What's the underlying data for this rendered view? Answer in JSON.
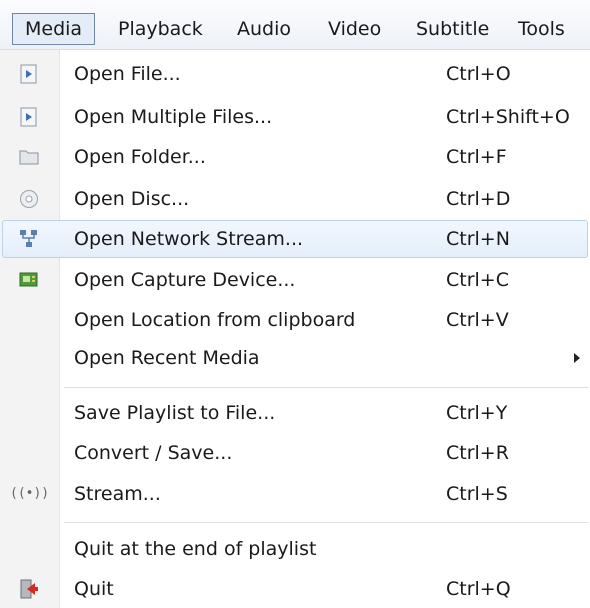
{
  "menubar": {
    "items": [
      {
        "label": "Media",
        "active": true
      },
      {
        "label": "Playback"
      },
      {
        "label": "Audio"
      },
      {
        "label": "Video"
      },
      {
        "label": "Subtitle"
      },
      {
        "label": "Tools"
      }
    ]
  },
  "menu": {
    "items": [
      {
        "label": "Open File...",
        "shortcut": "Ctrl+O",
        "icon": "file-play-icon"
      },
      {
        "label": "Open Multiple Files...",
        "shortcut": "Ctrl+Shift+O",
        "icon": "file-play-icon"
      },
      {
        "label": "Open Folder...",
        "shortcut": "Ctrl+F",
        "icon": "folder-icon"
      },
      {
        "label": "Open Disc...",
        "shortcut": "Ctrl+D",
        "icon": "disc-icon"
      },
      {
        "label": "Open Network Stream...",
        "shortcut": "Ctrl+N",
        "icon": "network-icon",
        "hovered": true
      },
      {
        "label": "Open Capture Device...",
        "shortcut": "Ctrl+C",
        "icon": "capture-card-icon"
      },
      {
        "label": "Open Location from clipboard",
        "shortcut": "Ctrl+V"
      },
      {
        "label": "Open Recent Media",
        "submenu": true
      },
      {
        "label": "Save Playlist to File...",
        "shortcut": "Ctrl+Y"
      },
      {
        "label": "Convert / Save...",
        "shortcut": "Ctrl+R"
      },
      {
        "label": "Stream...",
        "shortcut": "Ctrl+S",
        "icon": "stream-icon"
      },
      {
        "label": "Quit at the end of playlist"
      },
      {
        "label": "Quit",
        "shortcut": "Ctrl+Q",
        "icon": "quit-icon"
      }
    ],
    "stream_icon_glyph": "((•))"
  },
  "colors": {
    "hover_bg": "#e4eefb",
    "hover_border": "#b8d2f0",
    "gutter_bg": "#f3f3f3",
    "active_menu_border": "#6f87a8"
  }
}
